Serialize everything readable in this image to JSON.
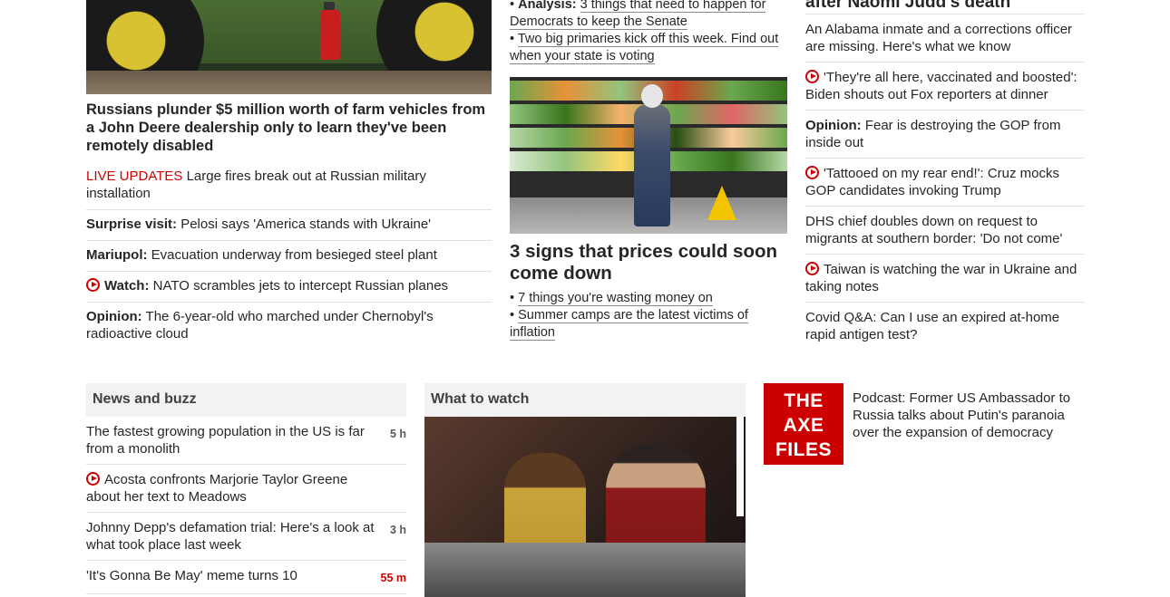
{
  "col1": {
    "hero_title": "Russians plunder $5 million worth of farm vehicles from a John Deere dealership only to learn they've been remotely disabled",
    "items": [
      {
        "prefix": "LIVE UPDATES",
        "text": " Large fires break out at Russian military installation"
      },
      {
        "prefix": "Surprise visit:",
        "text": " Pelosi says 'America stands with Ukraine'"
      },
      {
        "prefix": "Mariupol:",
        "text": " Evacuation underway from besieged steel plant"
      },
      {
        "prefix": "Watch:",
        "text": " NATO scrambles jets to intercept Russian planes"
      },
      {
        "prefix": "Opinion:",
        "text": " The 6-year-old who marched under Chernobyl's radioactive cloud"
      }
    ]
  },
  "col2": {
    "top_bullets": [
      {
        "bold": "Analysis:",
        "link": "3 things that need to happen for Democrats to keep the Senate"
      },
      {
        "link": "Two big primaries kick off this week. Find out when your state is voting"
      }
    ],
    "headline": "3 signs that prices could soon come down",
    "bullets": [
      "7 things you're wasting money on",
      "Summer camps are the latest victims of inflation"
    ]
  },
  "col3": {
    "title": "after Naomi Judd's death",
    "items": [
      {
        "text": "An Alabama inmate and a corrections officer are missing. Here's what we know"
      },
      {
        "video": true,
        "text": "'They're all here, vaccinated and boosted': Biden shouts out Fox reporters at dinner"
      },
      {
        "prefix": "Opinion:",
        "text": " Fear is destroying the GOP from inside out"
      },
      {
        "video": true,
        "text": "'Tattooed on my rear end!': Cruz mocks GOP candidates invoking Trump"
      },
      {
        "text": "DHS chief doubles down on request to migrants at southern border: 'Do not come'"
      },
      {
        "video": true,
        "text": "Taiwan is watching the war in Ukraine and taking notes"
      },
      {
        "text": "Covid Q&A: Can I use an expired at-home rapid antigen test?"
      }
    ]
  },
  "news": {
    "heading": "News and buzz",
    "items": [
      {
        "text": "The fastest growing population in the US is far from a monolith",
        "age": "5 h"
      },
      {
        "video": true,
        "text": "Acosta confronts Marjorie Taylor Greene about her text to Meadows",
        "age": ""
      },
      {
        "text": "Johnny Depp's defamation trial: Here's a look at what took place last week",
        "age": "3 h"
      },
      {
        "text": "'It's Gonna Be May' meme turns 10",
        "age": "55 m",
        "red": true
      }
    ]
  },
  "watch": {
    "heading": "What to watch"
  },
  "axe": {
    "logo_line1": "THE",
    "logo_line2": "AXE",
    "logo_line3": "FILES",
    "text": "Podcast: Former US Ambassador to Russia talks about Putin's paranoia over the expansion of democracy"
  },
  "colors": {
    "accent": "#cc0000",
    "text": "#262626",
    "divider": "#e0e0e0",
    "section_bg": "#f2f2f2"
  }
}
